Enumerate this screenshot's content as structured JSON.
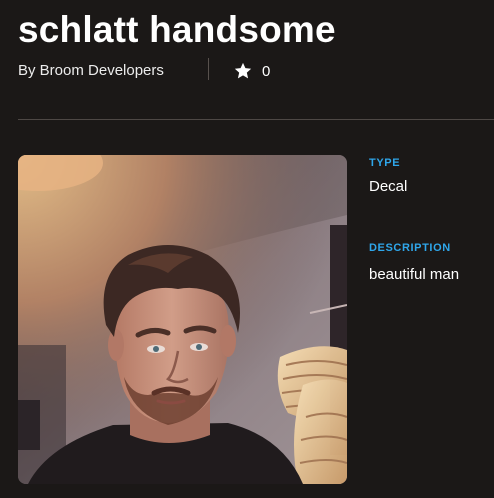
{
  "item": {
    "title": "schlatt handsome",
    "creator_text": "By Broom Developers",
    "favorites_count": "0",
    "favorite_icon": "star-icon",
    "thumbnail_alt": "Decal image: man with brown hair and beard in front of a pendant lamp"
  },
  "details": {
    "type_label": "TYPE",
    "type_value": "Decal",
    "description_label": "DESCRIPTION",
    "description_value": "beautiful man"
  },
  "colors": {
    "background": "#1b1817",
    "accent_label": "#2fa6ea",
    "divider": "#4e4845"
  }
}
